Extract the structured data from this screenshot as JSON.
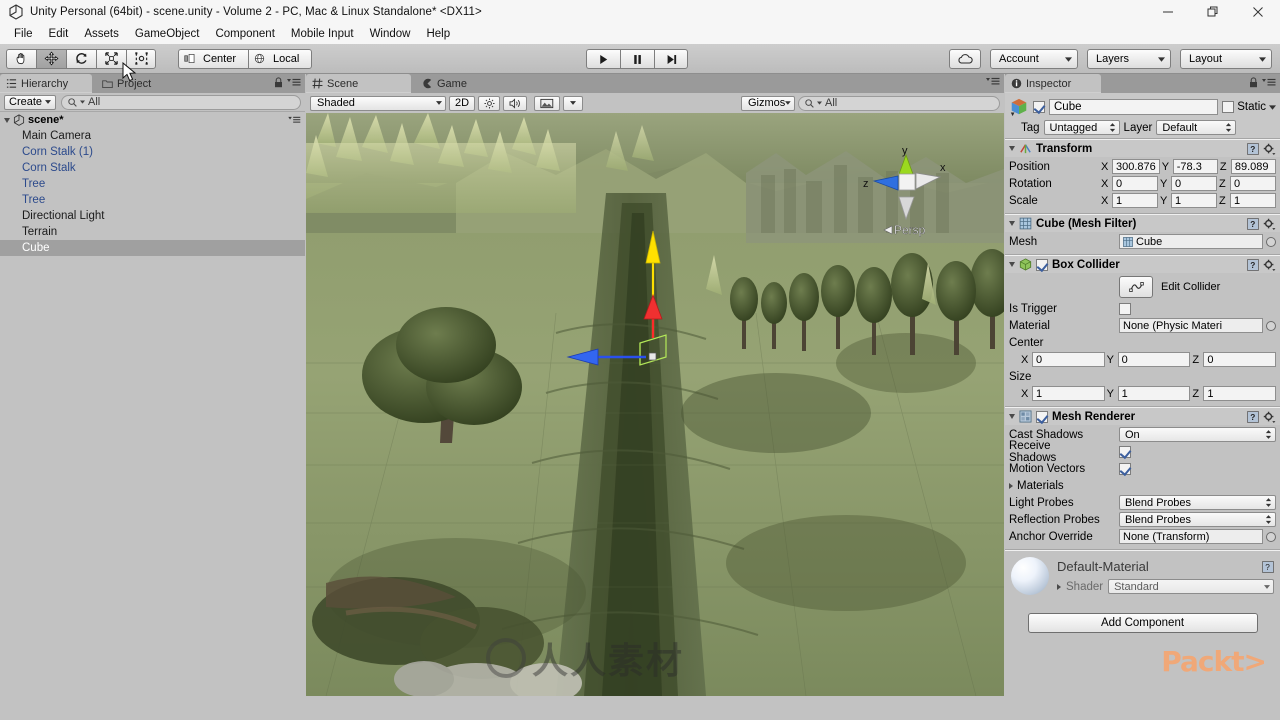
{
  "window": {
    "title": "Unity Personal (64bit) - scene.unity - Volume 2 - PC, Mac & Linux Standalone* <DX11>",
    "minimize": "minimize-icon",
    "maximize": "maximize-icon",
    "close": "close-icon"
  },
  "menubar": {
    "items": [
      "File",
      "Edit",
      "Assets",
      "GameObject",
      "Component",
      "Mobile Input",
      "Window",
      "Help"
    ]
  },
  "toolbar": {
    "tools": [
      {
        "name": "hand-tool",
        "icon": "hand-icon",
        "active": false
      },
      {
        "name": "move-tool",
        "icon": "move-icon",
        "active": true
      },
      {
        "name": "rotate-tool",
        "icon": "rotate-icon",
        "active": false
      },
      {
        "name": "scale-tool",
        "icon": "scale-icon",
        "active": false
      },
      {
        "name": "rect-tool",
        "icon": "rect-transform-icon",
        "active": false
      }
    ],
    "pivot_label": "Center",
    "space_label": "Local",
    "play": "play-icon",
    "pause": "pause-icon",
    "step": "step-icon",
    "cloud": "cloud-icon",
    "account_label": "Account",
    "layers_label": "Layers",
    "layout_label": "Layout"
  },
  "hierarchy": {
    "tab_label": "Hierarchy",
    "other_tab_label": "Project",
    "create_label": "Create",
    "search_placeholder": "All",
    "scene_name": "scene*",
    "items": [
      {
        "label": "Main Camera",
        "prefab": false,
        "selected": false
      },
      {
        "label": "Corn Stalk (1)",
        "prefab": true,
        "selected": false
      },
      {
        "label": "Corn Stalk",
        "prefab": true,
        "selected": false
      },
      {
        "label": "Tree",
        "prefab": true,
        "selected": false
      },
      {
        "label": "Tree",
        "prefab": true,
        "selected": false
      },
      {
        "label": "Directional Light",
        "prefab": false,
        "selected": false
      },
      {
        "label": "Terrain",
        "prefab": false,
        "selected": false
      },
      {
        "label": "Cube",
        "prefab": false,
        "selected": true
      }
    ]
  },
  "scene": {
    "tab_label": "Scene",
    "game_tab_label": "Game",
    "draw_mode": "Shaded",
    "view_2d_label": "2D",
    "lighting_icon": "sun-icon",
    "audio_icon": "speaker-icon",
    "effects_icon": "image-icon",
    "gizmos_label": "Gizmos",
    "search_placeholder": "All",
    "axis_x": "x",
    "axis_y": "y",
    "axis_z": "z",
    "perspective_label": "Persp"
  },
  "inspector": {
    "tab_label": "Inspector",
    "object_name": "Cube",
    "enabled": true,
    "static_label": "Static",
    "tag_label": "Tag",
    "tag_value": "Untagged",
    "layer_label": "Layer",
    "layer_value": "Default",
    "transform": {
      "title": "Transform",
      "rows": [
        {
          "label": "Position",
          "x": "300.876",
          "y": "-78.3",
          "z": "89.089"
        },
        {
          "label": "Rotation",
          "x": "0",
          "y": "0",
          "z": "0"
        },
        {
          "label": "Scale",
          "x": "1",
          "y": "1",
          "z": "1"
        }
      ]
    },
    "mesh_filter": {
      "title": "Cube (Mesh Filter)",
      "mesh_label": "Mesh",
      "mesh_value": "Cube"
    },
    "box_collider": {
      "title": "Box Collider",
      "enabled": true,
      "edit_collider_label": "Edit Collider",
      "is_trigger_label": "Is Trigger",
      "is_trigger_value": false,
      "material_label": "Material",
      "material_value": "None (Physic Materi",
      "center_label": "Center",
      "center": {
        "x": "0",
        "y": "0",
        "z": "0"
      },
      "size_label": "Size",
      "size": {
        "x": "1",
        "y": "1",
        "z": "1"
      }
    },
    "mesh_renderer": {
      "title": "Mesh Renderer",
      "enabled": true,
      "cast_shadows_label": "Cast Shadows",
      "cast_shadows_value": "On",
      "receive_shadows_label": "Receive Shadows",
      "receive_shadows_value": true,
      "motion_vectors_label": "Motion Vectors",
      "motion_vectors_value": true,
      "materials_label": "Materials",
      "light_probes_label": "Light Probes",
      "light_probes_value": "Blend Probes",
      "reflection_probes_label": "Reflection Probes",
      "reflection_probes_value": "Blend Probes",
      "anchor_override_label": "Anchor Override",
      "anchor_override_value": "None (Transform)"
    },
    "material": {
      "name": "Default-Material",
      "shader_label": "Shader",
      "shader_value": "Standard"
    },
    "add_component_label": "Add Component"
  },
  "watermark": {
    "text": "人人素材",
    "packt": "Packt>"
  },
  "colors": {
    "panel_bg": "#c2c2c2",
    "tab_bar": "#9a9a9a",
    "prefab_blue": "#2c4a8c",
    "selection": "#a0a0a0",
    "accent_orange": "#f0a878",
    "gizmo_y": "#ffe000",
    "gizmo_x": "#ff2222",
    "gizmo_z": "#2255ee"
  }
}
